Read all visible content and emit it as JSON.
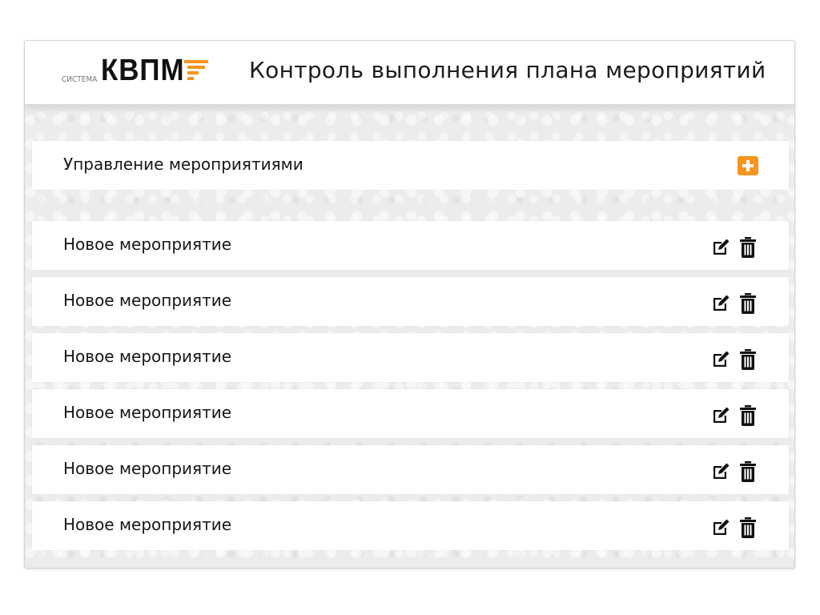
{
  "header": {
    "logo_small": "СИСТЕМА",
    "logo_big": "КВПМ",
    "title": "Контроль выполнения плана мероприятий"
  },
  "management": {
    "label": "Управление мероприятиями",
    "add_icon": "plus-square-icon"
  },
  "events": [
    {
      "name": "Новое мероприятие"
    },
    {
      "name": "Новое мероприятие"
    },
    {
      "name": "Новое мероприятие"
    },
    {
      "name": "Новое мероприятие"
    },
    {
      "name": "Новое мероприятие"
    },
    {
      "name": "Новое мероприятие"
    }
  ],
  "icons": {
    "edit": "edit-icon",
    "delete": "trash-icon"
  },
  "colors": {
    "accent": "#f7941d",
    "background": "#ececec",
    "text": "#161616"
  }
}
